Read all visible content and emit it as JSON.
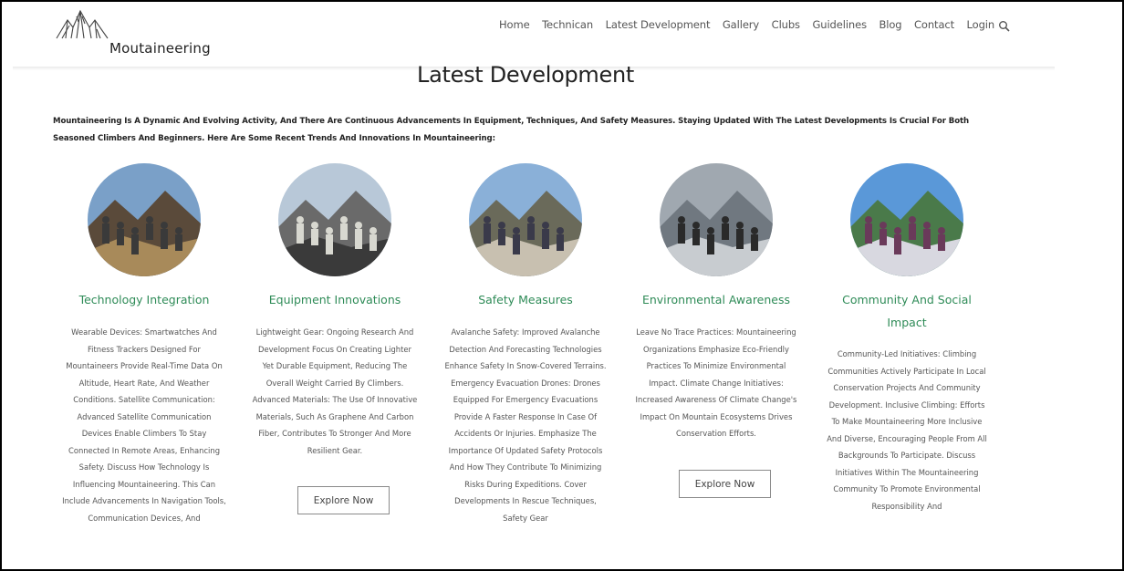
{
  "site": {
    "brand": "Moutaineering",
    "logo_icon": "mountain-icon"
  },
  "nav": {
    "items": [
      "Home",
      "Technican",
      "Latest Development",
      "Gallery",
      "Clubs",
      "Guidelines",
      "Blog",
      "Contact",
      "Login"
    ],
    "search_icon": "search-icon"
  },
  "page": {
    "title": "Latest Development",
    "intro": "Mountaineering Is A Dynamic And Evolving Activity, And There Are Continuous Advancements In Equipment, Techniques, And Safety Measures. Staying Updated With The Latest Developments Is Crucial For Both Seasoned Climbers And Beginners. Here Are Some Recent Trends And Innovations In Mountaineering:"
  },
  "cards": [
    {
      "title": "Technology Integration",
      "body": "Wearable Devices: Smartwatches And Fitness Trackers Designed For Mountaineers Provide Real-Time Data On Altitude, Heart Rate, And Weather Conditions. Satellite Communication: Advanced Satellite Communication Devices Enable Climbers To Stay Connected In Remote Areas, Enhancing Safety. Discuss How Technology Is Influencing Mountaineering. This Can Include Advancements In Navigation Tools, Communication Devices, And"
    },
    {
      "title": "Equipment Innovations",
      "body": "Lightweight Gear: Ongoing Research And Development Focus On Creating Lighter Yet Durable Equipment, Reducing The Overall Weight Carried By Climbers. Advanced Materials: The Use Of Innovative Materials, Such As Graphene And Carbon Fiber, Contributes To Stronger And More Resilient Gear.",
      "button": "Explore Now"
    },
    {
      "title": "Safety Measures",
      "body": "Avalanche Safety: Improved Avalanche Detection And Forecasting Technologies Enhance Safety In Snow-Covered Terrains. Emergency Evacuation Drones: Drones Equipped For Emergency Evacuations Provide A Faster Response In Case Of Accidents Or Injuries. Emphasize The Importance Of Updated Safety Protocols And How They Contribute To Minimizing Risks During Expeditions. Cover Developments In Rescue Techniques, Safety Gear"
    },
    {
      "title": "Environmental Awareness",
      "body": "Leave No Trace Practices: Mountaineering Organizations Emphasize Eco-Friendly Practices To Minimize Environmental Impact. Climate Change Initiatives: Increased Awareness Of Climate Change's Impact On Mountain Ecosystems Drives Conservation Efforts.",
      "button": "Explore Now"
    },
    {
      "title": "Community And Social Impact",
      "body": "Community-Led Initiatives: Climbing Communities Actively Participate In Local Conservation Projects And Community Development. Inclusive Climbing: Efforts To Make Mountaineering More Inclusive And Diverse, Encouraging People From All Backgrounds To Participate. Discuss Initiatives Within The Mountaineering Community To Promote Environmental Responsibility And"
    }
  ],
  "colors": {
    "accent_green": "#2e8b57",
    "text_dark": "#222222",
    "text_muted": "#555555"
  }
}
